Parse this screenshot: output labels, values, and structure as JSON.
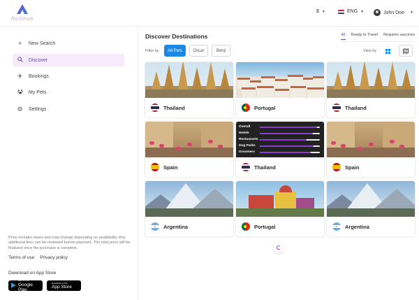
{
  "brand": {
    "name": "Avvinue"
  },
  "header": {
    "currency": "$",
    "language": "ENG",
    "user_name": "John Doe"
  },
  "sidebar": {
    "items": [
      {
        "label": "New Search",
        "icon": "plus-icon",
        "active": false
      },
      {
        "label": "Discover",
        "icon": "search-icon",
        "active": true
      },
      {
        "label": "Bookings",
        "icon": "plane-icon",
        "active": false
      },
      {
        "label": "My Pets",
        "icon": "paw-icon",
        "active": false
      },
      {
        "label": "Settings",
        "icon": "gear-icon",
        "active": false
      }
    ],
    "disclaimer": "Price includes taxes and may change depending on availability. Any additional fees can be reviewed before payment. The total price will be finalized once the purchase is complete.",
    "links": [
      "Terms of use",
      "Privacy policy"
    ],
    "download_label": "Download on App Store",
    "google_play": {
      "small": "GET IT ON",
      "big": "Google Play"
    },
    "app_store": {
      "small": "Download on the",
      "big": "App Store"
    }
  },
  "main": {
    "title": "Discover Destinations",
    "sort_tabs": [
      "All",
      "Ready to Travel",
      "Requires vaccines"
    ],
    "filter_label": "Filter by",
    "filters": [
      {
        "label": "All Pets",
        "active": true
      },
      {
        "label": "Oscar",
        "active": false
      },
      {
        "label": "Benji",
        "active": false
      }
    ],
    "view_by_label": "View by",
    "cards": [
      {
        "country": "Thailand",
        "flag": "TH",
        "scene": "temple"
      },
      {
        "country": "Portugal",
        "flag": "PT",
        "scene": "lisbon"
      },
      {
        "country": "Thailand",
        "flag": "TH",
        "scene": "temple"
      },
      {
        "country": "Spain",
        "flag": "ES",
        "scene": "street"
      },
      {
        "country": "Thailand",
        "flag": "TH",
        "scene": "ratings"
      },
      {
        "country": "Spain",
        "flag": "ES",
        "scene": "street"
      },
      {
        "country": "Argentina",
        "flag": "AR",
        "scene": "mountains"
      },
      {
        "country": "Portugal",
        "flag": "PT",
        "scene": "palace"
      },
      {
        "country": "Argentina",
        "flag": "AR",
        "scene": "mountains"
      }
    ],
    "ratings": [
      {
        "label": "Overall",
        "value": 0.95
      },
      {
        "label": "Hotels",
        "value": 0.88
      },
      {
        "label": "Restaurants",
        "value": 0.78
      },
      {
        "label": "Dog Parks",
        "value": 0.9
      },
      {
        "label": "Groomers",
        "value": 0.85
      }
    ]
  },
  "colors": {
    "accent": "#8a3fd1",
    "primary": "#1e88e5",
    "active_nav_bg": "#f7ebfb"
  }
}
